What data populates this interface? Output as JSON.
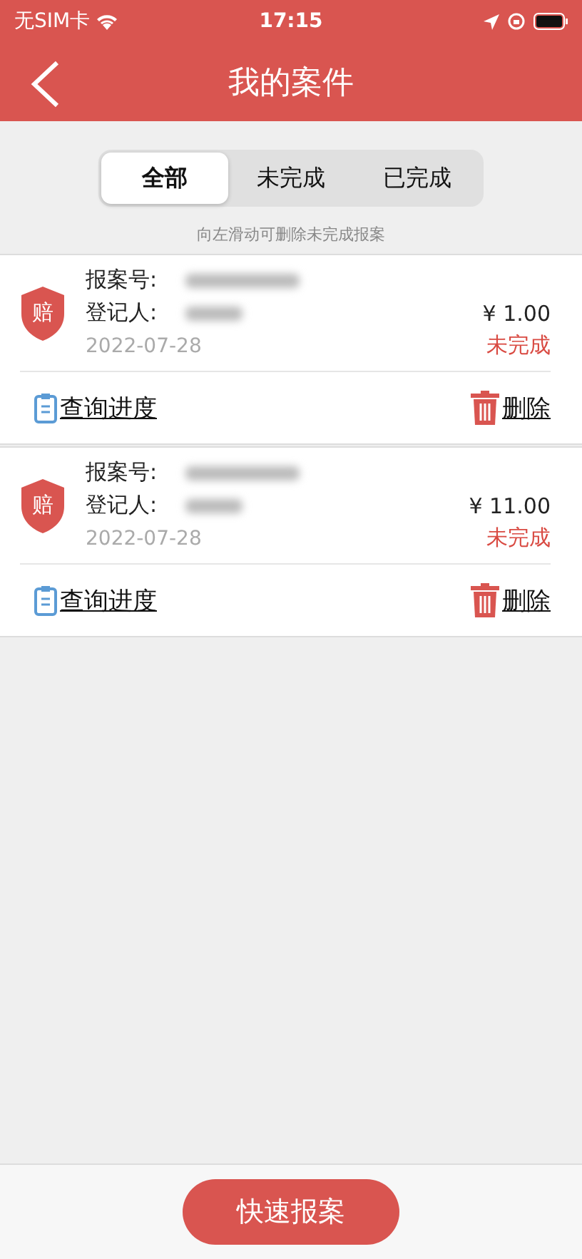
{
  "status_bar": {
    "carrier": "无SIM卡",
    "time": "17:15"
  },
  "header": {
    "title": "我的案件"
  },
  "tabs": [
    {
      "label": "全部",
      "selected": true
    },
    {
      "label": "未完成",
      "selected": false
    },
    {
      "label": "已完成",
      "selected": false
    }
  ],
  "hint": "向左滑动可删除未完成报案",
  "cases": [
    {
      "badge": "赔",
      "number_label": "报案号:",
      "person_label": "登记人:",
      "amount": "¥ 1.00",
      "date": "2022-07-28",
      "status": "未完成",
      "progress_link": "查询进度",
      "delete_link": "删除"
    },
    {
      "badge": "赔",
      "number_label": "报案号:",
      "person_label": "登记人:",
      "amount": "¥ 11.00",
      "date": "2022-07-28",
      "status": "未完成",
      "progress_link": "查询进度",
      "delete_link": "删除"
    }
  ],
  "primary_button": "快速报案"
}
